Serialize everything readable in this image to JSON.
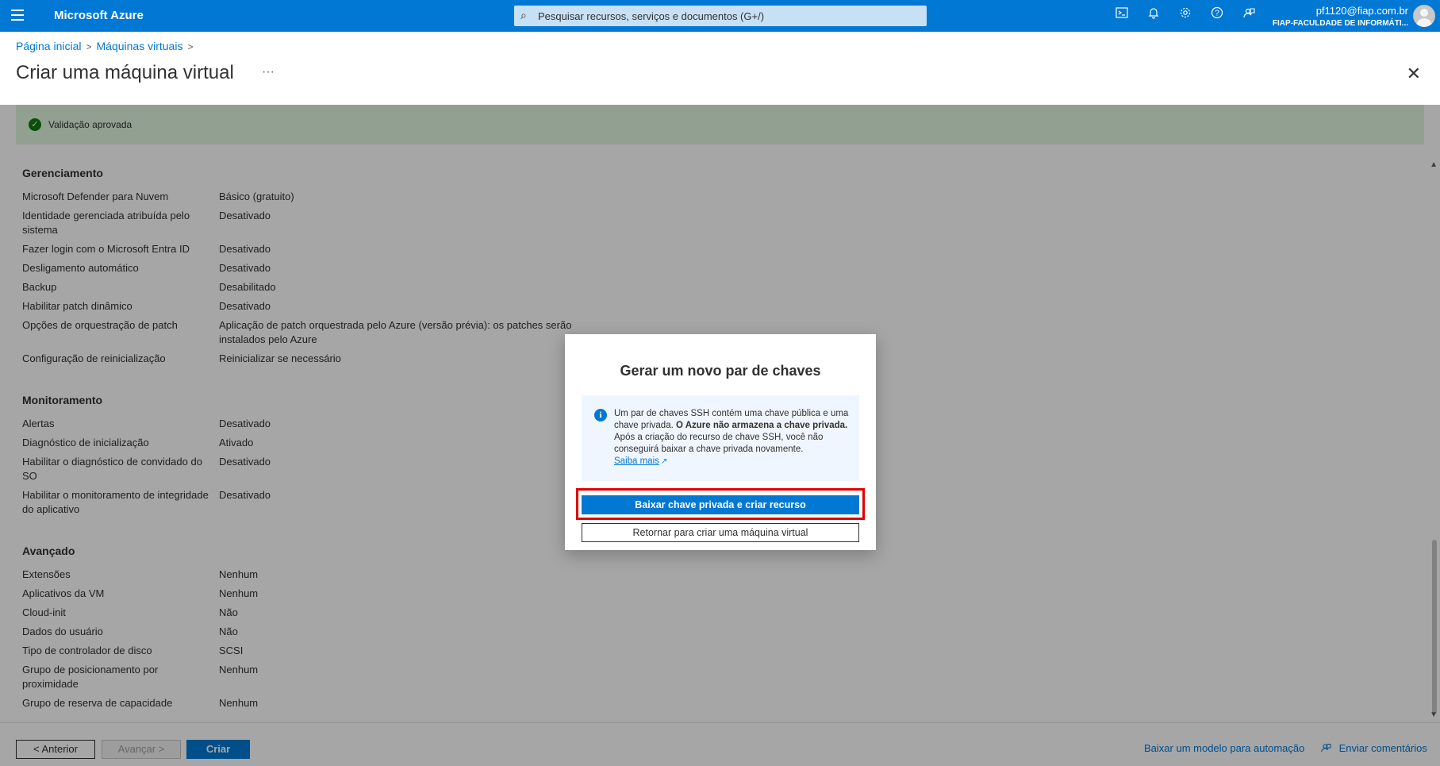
{
  "topbar": {
    "brand": "Microsoft Azure",
    "search_placeholder": "Pesquisar recursos, serviços e documentos (G+/)",
    "user_email": "pf1120@fiap.com.br",
    "user_tenant": "FIAP-FACULDADE DE INFORMÁTI..."
  },
  "breadcrumb": {
    "home": "Página inicial",
    "vms": "Máquinas virtuais"
  },
  "page": {
    "title": "Criar uma máquina virtual",
    "more": "···",
    "close": "✕"
  },
  "banner": {
    "text": "Validação aprovada"
  },
  "sections": {
    "gerenciamento": {
      "title": "Gerenciamento",
      "rows": [
        {
          "label": "Microsoft Defender para Nuvem",
          "value": "Básico (gratuito)"
        },
        {
          "label": "Identidade gerenciada atribuída pelo sistema",
          "value": "Desativado"
        },
        {
          "label": "Fazer login com o Microsoft Entra ID",
          "value": "Desativado"
        },
        {
          "label": "Desligamento automático",
          "value": "Desativado"
        },
        {
          "label": "Backup",
          "value": "Desabilitado"
        },
        {
          "label": "Habilitar patch dinâmico",
          "value": "Desativado"
        },
        {
          "label": "Opções de orquestração de patch",
          "value": "Aplicação de patch orquestrada pelo Azure (versão prévia): os patches serão instalados pelo Azure"
        },
        {
          "label": "Configuração de reinicialização",
          "value": "Reinicializar se necessário"
        }
      ]
    },
    "monitoramento": {
      "title": "Monitoramento",
      "rows": [
        {
          "label": "Alertas",
          "value": "Desativado"
        },
        {
          "label": "Diagnóstico de inicialização",
          "value": "Ativado"
        },
        {
          "label": "Habilitar o diagnóstico de convidado do SO",
          "value": "Desativado"
        },
        {
          "label": "Habilitar o monitoramento de integridade do aplicativo",
          "value": "Desativado"
        }
      ]
    },
    "avancado": {
      "title": "Avançado",
      "rows": [
        {
          "label": "Extensões",
          "value": "Nenhum"
        },
        {
          "label": "Aplicativos da VM",
          "value": "Nenhum"
        },
        {
          "label": "Cloud-init",
          "value": "Não"
        },
        {
          "label": "Dados do usuário",
          "value": "Não"
        },
        {
          "label": "Tipo de controlador de disco",
          "value": "SCSI"
        },
        {
          "label": "Grupo de posicionamento por proximidade",
          "value": "Nenhum"
        },
        {
          "label": "Grupo de reserva de capacidade",
          "value": "Nenhum"
        }
      ]
    }
  },
  "footer": {
    "prev": "< Anterior",
    "next": "Avançar >",
    "create": "Criar",
    "download_template": "Baixar um modelo para automação",
    "feedback": "Enviar comentários"
  },
  "modal": {
    "title": "Gerar um novo par de chaves",
    "info_part1": "Um par de chaves SSH contém uma chave pública e uma chave privada. ",
    "info_bold": "O Azure não armazena a chave privada.",
    "info_part2": " Após a criação do recurso de chave SSH, você não conseguirá baixar a chave privada novamente.",
    "learn_more": "Saiba mais",
    "primary_button": "Baixar chave privada e criar recurso",
    "secondary_button": "Retornar para criar uma máquina virtual"
  },
  "colors": {
    "accent": "#0078d4",
    "success": "#107c10",
    "highlight": "#e00000"
  },
  "icons": [
    "hamburger-icon",
    "search-icon",
    "cloud-shell-icon",
    "bell-icon",
    "gear-icon",
    "help-icon",
    "feedback-icon",
    "avatar",
    "check-icon",
    "info-icon",
    "external-link-icon",
    "close-icon"
  ]
}
